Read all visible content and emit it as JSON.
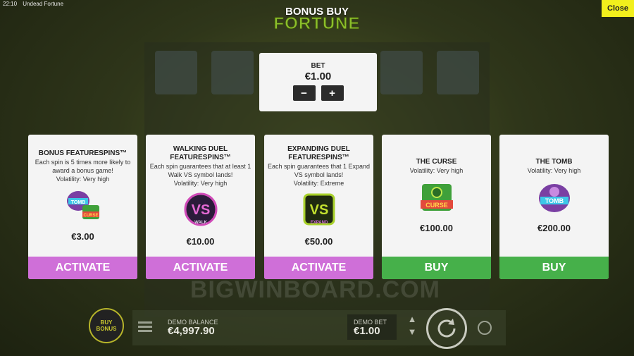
{
  "topbar": {
    "time": "22:10",
    "game": "Undead Fortune"
  },
  "close_label": "Close",
  "logo_text": "FORTUNE",
  "title": "BONUS BUY",
  "bet": {
    "label": "BET",
    "value": "€1.00",
    "minus": "−",
    "plus": "+"
  },
  "cards": [
    {
      "name": "BONUS FEATURESPINS™",
      "desc": "Each spin is 5 times more likely to award a bonus game!",
      "volatility": "Volatility: Very high",
      "price": "€3.00",
      "button": "ACTIVATE"
    },
    {
      "name": "WALKING DUEL FEATURESPINS™",
      "desc": "Each spin guarantees that at least 1 Walk VS symbol lands!",
      "volatility": "Volatility: Very high",
      "price": "€10.00",
      "button": "ACTIVATE"
    },
    {
      "name": "EXPANDING DUEL FEATURESPINS™",
      "desc": "Each spin guarantees that 1 Expand VS symbol lands!",
      "volatility": "Volatility: Extreme",
      "price": "€50.00",
      "button": "ACTIVATE"
    },
    {
      "name": "THE CURSE",
      "desc": "",
      "volatility": "Volatility: Very high",
      "price": "€100.00",
      "button": "BUY"
    },
    {
      "name": "THE TOMB",
      "desc": "",
      "volatility": "Volatility: Very high",
      "price": "€200.00",
      "button": "BUY"
    }
  ],
  "icons": {
    "vs": "VS",
    "walk": "WALK",
    "expand": "EXPAND",
    "curse": "CURSE",
    "tomb": "TOMB"
  },
  "watermark": "BIGWINBOARD.COM",
  "bottom": {
    "buy_bonus": "BUY BONUS",
    "balance_label": "DEMO BALANCE",
    "balance_value": "€4,997.90",
    "bet_label": "DEMO BET",
    "bet_value": "€1.00"
  },
  "colors": {
    "activate": "#cf6fd8",
    "buy": "#46b04a",
    "close": "#f2ef1c"
  }
}
